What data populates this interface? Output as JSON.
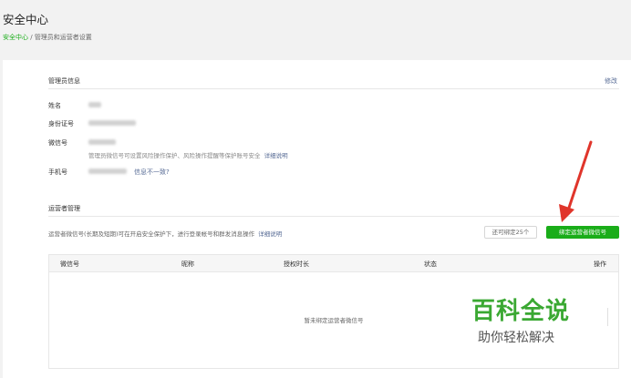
{
  "header": {
    "title": "安全中心",
    "breadcrumb": {
      "link": "安全中心",
      "separator": " / ",
      "current": "管理员和运营者设置"
    }
  },
  "admin": {
    "section_title": "管理员信息",
    "edit_link": "修改",
    "labels": {
      "name": "姓名",
      "id_number": "身份证号",
      "wechat": "微信号",
      "phone": "手机号"
    },
    "wechat_note": "管理员微信号可设置风险操作保护、风险操作提醒等保护账号安全",
    "wechat_note_link": "详细说明",
    "phone_mismatch_link": "信息不一致?"
  },
  "operators": {
    "section_title": "运营者管理",
    "description": "运营者微信号(长期及短期)可在开启安全保护下，进行登录帐号和群发消息操作",
    "description_link": "详细说明",
    "quota_button": "还可绑定25个",
    "bind_button": "绑定运营者微信号",
    "table": {
      "columns": [
        "微信号",
        "昵称",
        "授权时长",
        "状态",
        "操作"
      ],
      "empty_text": "暂未绑定运营者微信号"
    }
  },
  "watermark": {
    "title": "百科全说",
    "subtitle": "助你轻松解决"
  },
  "colors": {
    "accent": "#1aad19",
    "link": "#576b95",
    "arrow": "#e0352b",
    "watermark": "#3aa832"
  }
}
